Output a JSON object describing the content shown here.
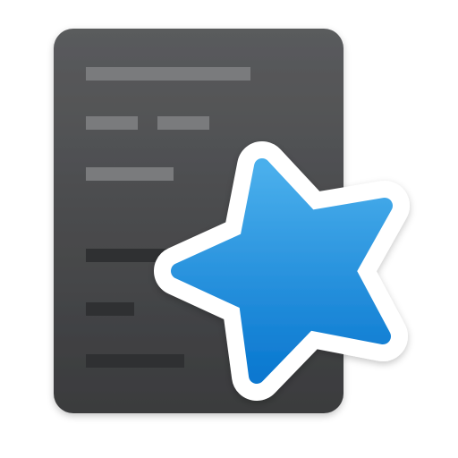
{
  "icon": {
    "name": "anki-app-icon",
    "card": {
      "color_top": "#5a5b5d",
      "color_bottom": "#3a3b3d",
      "line_light": "#7a7b7d",
      "line_dark": "#2f3032"
    },
    "star": {
      "color_top": "#4aafec",
      "color_bottom": "#0a78d0",
      "outline": "#ffffff"
    }
  }
}
